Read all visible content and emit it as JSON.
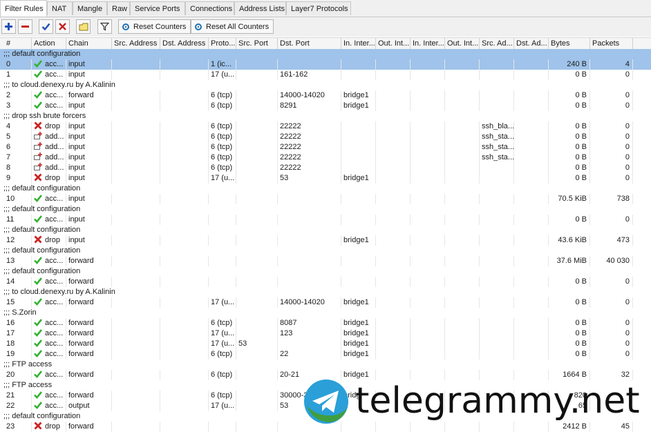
{
  "tabs": [
    "Filter Rules",
    "NAT",
    "Mangle",
    "Raw",
    "Service Ports",
    "Connections",
    "Address Lists",
    "Layer7 Protocols"
  ],
  "active_tab": 0,
  "toolbar": {
    "add_icon": "plus-icon",
    "remove_icon": "minus-icon",
    "enable_icon": "check-icon",
    "disable_icon": "x-icon",
    "comment_icon": "note-icon",
    "filter_icon": "funnel-icon",
    "reset_counters": "Reset Counters",
    "reset_all_counters": "Reset All Counters"
  },
  "columns": [
    "#",
    "Action",
    "Chain",
    "Src. Address",
    "Dst. Address",
    "Proto...",
    "Src. Port",
    "Dst. Port",
    "In. Inter...",
    "Out. Int...",
    "In. Inter...",
    "Out. Int...",
    "Src. Ad...",
    "Dst. Ad...",
    "Bytes",
    "Packets"
  ],
  "colors": {
    "selected_row": "#9fc3ea",
    "accept": "#33b233",
    "drop": "#cc2222",
    "add": "#555555",
    "watermark_blue": "#2a9fd8",
    "watermark_green": "#4caf50"
  },
  "rows": [
    {
      "type": "comment",
      "text": ";;; default configuration",
      "selected": true
    },
    {
      "type": "rule",
      "num": "0",
      "action": "acc...",
      "icon": "accept",
      "chain": "input",
      "src_addr": "",
      "dst_addr": "",
      "proto": "1 (ic...",
      "src_port": "",
      "dst_port": "",
      "in_if": "",
      "out_if": "",
      "in_if_list": "",
      "out_if_list": "",
      "src_list": "",
      "dst_list": "",
      "bytes": "240 B",
      "packets": "4",
      "selected": true
    },
    {
      "type": "rule",
      "num": "1",
      "action": "acc...",
      "icon": "accept",
      "chain": "input",
      "src_addr": "",
      "dst_addr": "",
      "proto": "17 (u...",
      "src_port": "",
      "dst_port": "161-162",
      "in_if": "",
      "out_if": "",
      "in_if_list": "",
      "out_if_list": "",
      "src_list": "",
      "dst_list": "",
      "bytes": "0 B",
      "packets": "0"
    },
    {
      "type": "comment",
      "text": ";;; to cloud.denexy.ru by A.Kalinin"
    },
    {
      "type": "rule",
      "num": "2",
      "action": "acc...",
      "icon": "accept",
      "chain": "forward",
      "src_addr": "",
      "dst_addr": "",
      "proto": "6 (tcp)",
      "src_port": "",
      "dst_port": "14000-14020",
      "in_if": "bridge1",
      "out_if": "",
      "in_if_list": "",
      "out_if_list": "",
      "src_list": "",
      "dst_list": "",
      "bytes": "0 B",
      "packets": "0"
    },
    {
      "type": "rule",
      "num": "3",
      "action": "acc...",
      "icon": "accept",
      "chain": "input",
      "src_addr": "",
      "dst_addr": "",
      "proto": "6 (tcp)",
      "src_port": "",
      "dst_port": "8291",
      "in_if": "bridge1",
      "out_if": "",
      "in_if_list": "",
      "out_if_list": "",
      "src_list": "",
      "dst_list": "",
      "bytes": "0 B",
      "packets": "0"
    },
    {
      "type": "comment",
      "text": ";;; drop ssh brute forcers"
    },
    {
      "type": "rule",
      "num": "4",
      "action": "drop",
      "icon": "drop",
      "chain": "input",
      "src_addr": "",
      "dst_addr": "",
      "proto": "6 (tcp)",
      "src_port": "",
      "dst_port": "22222",
      "in_if": "",
      "out_if": "",
      "in_if_list": "",
      "out_if_list": "",
      "src_list": "ssh_bla...",
      "dst_list": "",
      "bytes": "0 B",
      "packets": "0"
    },
    {
      "type": "rule",
      "num": "5",
      "action": "add...",
      "icon": "add",
      "chain": "input",
      "src_addr": "",
      "dst_addr": "",
      "proto": "6 (tcp)",
      "src_port": "",
      "dst_port": "22222",
      "in_if": "",
      "out_if": "",
      "in_if_list": "",
      "out_if_list": "",
      "src_list": "ssh_sta...",
      "dst_list": "",
      "bytes": "0 B",
      "packets": "0"
    },
    {
      "type": "rule",
      "num": "6",
      "action": "add...",
      "icon": "add",
      "chain": "input",
      "src_addr": "",
      "dst_addr": "",
      "proto": "6 (tcp)",
      "src_port": "",
      "dst_port": "22222",
      "in_if": "",
      "out_if": "",
      "in_if_list": "",
      "out_if_list": "",
      "src_list": "ssh_sta...",
      "dst_list": "",
      "bytes": "0 B",
      "packets": "0"
    },
    {
      "type": "rule",
      "num": "7",
      "action": "add...",
      "icon": "add",
      "chain": "input",
      "src_addr": "",
      "dst_addr": "",
      "proto": "6 (tcp)",
      "src_port": "",
      "dst_port": "22222",
      "in_if": "",
      "out_if": "",
      "in_if_list": "",
      "out_if_list": "",
      "src_list": "ssh_sta...",
      "dst_list": "",
      "bytes": "0 B",
      "packets": "0"
    },
    {
      "type": "rule",
      "num": "8",
      "action": "add...",
      "icon": "add",
      "chain": "input",
      "src_addr": "",
      "dst_addr": "",
      "proto": "6 (tcp)",
      "src_port": "",
      "dst_port": "22222",
      "in_if": "",
      "out_if": "",
      "in_if_list": "",
      "out_if_list": "",
      "src_list": "",
      "dst_list": "",
      "bytes": "0 B",
      "packets": "0"
    },
    {
      "type": "rule",
      "num": "9",
      "action": "drop",
      "icon": "drop",
      "chain": "input",
      "src_addr": "",
      "dst_addr": "",
      "proto": "17 (u...",
      "src_port": "",
      "dst_port": "53",
      "in_if": "bridge1",
      "out_if": "",
      "in_if_list": "",
      "out_if_list": "",
      "src_list": "",
      "dst_list": "",
      "bytes": "0 B",
      "packets": "0"
    },
    {
      "type": "comment",
      "text": ";;; default configuration"
    },
    {
      "type": "rule",
      "num": "10",
      "action": "acc...",
      "icon": "accept",
      "chain": "input",
      "src_addr": "",
      "dst_addr": "",
      "proto": "",
      "src_port": "",
      "dst_port": "",
      "in_if": "",
      "out_if": "",
      "in_if_list": "",
      "out_if_list": "",
      "src_list": "",
      "dst_list": "",
      "bytes": "70.5 KiB",
      "packets": "738"
    },
    {
      "type": "comment",
      "text": ";;; default configuration"
    },
    {
      "type": "rule",
      "num": "11",
      "action": "acc...",
      "icon": "accept",
      "chain": "input",
      "src_addr": "",
      "dst_addr": "",
      "proto": "",
      "src_port": "",
      "dst_port": "",
      "in_if": "",
      "out_if": "",
      "in_if_list": "",
      "out_if_list": "",
      "src_list": "",
      "dst_list": "",
      "bytes": "0 B",
      "packets": "0"
    },
    {
      "type": "comment",
      "text": ";;; default configuration"
    },
    {
      "type": "rule",
      "num": "12",
      "action": "drop",
      "icon": "drop",
      "chain": "input",
      "src_addr": "",
      "dst_addr": "",
      "proto": "",
      "src_port": "",
      "dst_port": "",
      "in_if": "bridge1",
      "out_if": "",
      "in_if_list": "",
      "out_if_list": "",
      "src_list": "",
      "dst_list": "",
      "bytes": "43.6 KiB",
      "packets": "473"
    },
    {
      "type": "comment",
      "text": ";;; default configuration"
    },
    {
      "type": "rule",
      "num": "13",
      "action": "acc...",
      "icon": "accept",
      "chain": "forward",
      "src_addr": "",
      "dst_addr": "",
      "proto": "",
      "src_port": "",
      "dst_port": "",
      "in_if": "",
      "out_if": "",
      "in_if_list": "",
      "out_if_list": "",
      "src_list": "",
      "dst_list": "",
      "bytes": "37.6 MiB",
      "packets": "40 030"
    },
    {
      "type": "comment",
      "text": ";;; default configuration"
    },
    {
      "type": "rule",
      "num": "14",
      "action": "acc...",
      "icon": "accept",
      "chain": "forward",
      "src_addr": "",
      "dst_addr": "",
      "proto": "",
      "src_port": "",
      "dst_port": "",
      "in_if": "",
      "out_if": "",
      "in_if_list": "",
      "out_if_list": "",
      "src_list": "",
      "dst_list": "",
      "bytes": "0 B",
      "packets": "0"
    },
    {
      "type": "comment",
      "text": ";;; to cloud.denexy.ru by A.Kalinin"
    },
    {
      "type": "rule",
      "num": "15",
      "action": "acc...",
      "icon": "accept",
      "chain": "forward",
      "src_addr": "",
      "dst_addr": "",
      "proto": "17 (u...",
      "src_port": "",
      "dst_port": "14000-14020",
      "in_if": "bridge1",
      "out_if": "",
      "in_if_list": "",
      "out_if_list": "",
      "src_list": "",
      "dst_list": "",
      "bytes": "0 B",
      "packets": "0"
    },
    {
      "type": "comment",
      "text": ";;; S.Zorin"
    },
    {
      "type": "rule",
      "num": "16",
      "action": "acc...",
      "icon": "accept",
      "chain": "forward",
      "src_addr": "",
      "dst_addr": "",
      "proto": "6 (tcp)",
      "src_port": "",
      "dst_port": "8087",
      "in_if": "bridge1",
      "out_if": "",
      "in_if_list": "",
      "out_if_list": "",
      "src_list": "",
      "dst_list": "",
      "bytes": "0 B",
      "packets": "0"
    },
    {
      "type": "rule",
      "num": "17",
      "action": "acc...",
      "icon": "accept",
      "chain": "forward",
      "src_addr": "",
      "dst_addr": "",
      "proto": "17 (u...",
      "src_port": "",
      "dst_port": "123",
      "in_if": "bridge1",
      "out_if": "",
      "in_if_list": "",
      "out_if_list": "",
      "src_list": "",
      "dst_list": "",
      "bytes": "0 B",
      "packets": "0"
    },
    {
      "type": "rule",
      "num": "18",
      "action": "acc...",
      "icon": "accept",
      "chain": "forward",
      "src_addr": "",
      "dst_addr": "",
      "proto": "17 (u...",
      "src_port": "53",
      "dst_port": "",
      "in_if": "bridge1",
      "out_if": "",
      "in_if_list": "",
      "out_if_list": "",
      "src_list": "",
      "dst_list": "",
      "bytes": "0 B",
      "packets": "0"
    },
    {
      "type": "rule",
      "num": "19",
      "action": "acc...",
      "icon": "accept",
      "chain": "forward",
      "src_addr": "",
      "dst_addr": "",
      "proto": "6 (tcp)",
      "src_port": "",
      "dst_port": "22",
      "in_if": "bridge1",
      "out_if": "",
      "in_if_list": "",
      "out_if_list": "",
      "src_list": "",
      "dst_list": "",
      "bytes": "0 B",
      "packets": "0"
    },
    {
      "type": "comment",
      "text": ";;; FTP access"
    },
    {
      "type": "rule",
      "num": "20",
      "action": "acc...",
      "icon": "accept",
      "chain": "forward",
      "src_addr": "",
      "dst_addr": "",
      "proto": "6 (tcp)",
      "src_port": "",
      "dst_port": "20-21",
      "in_if": "bridge1",
      "out_if": "",
      "in_if_list": "",
      "out_if_list": "",
      "src_list": "",
      "dst_list": "",
      "bytes": "1664 B",
      "packets": "32"
    },
    {
      "type": "comment",
      "text": ";;; FTP access"
    },
    {
      "type": "rule",
      "num": "21",
      "action": "acc...",
      "icon": "accept",
      "chain": "forward",
      "src_addr": "",
      "dst_addr": "",
      "proto": "6 (tcp)",
      "src_port": "",
      "dst_port": "30000-3",
      "in_if": "bridg",
      "out_if": "",
      "in_if_list": "",
      "out_if_list": "",
      "src_list": "",
      "dst_list": "",
      "bytes": "820",
      "packets": ""
    },
    {
      "type": "rule",
      "num": "22",
      "action": "acc...",
      "icon": "accept",
      "chain": "output",
      "src_addr": "",
      "dst_addr": "",
      "proto": "17 (u...",
      "src_port": "",
      "dst_port": "53",
      "in_if": "",
      "out_if": "",
      "in_if_list": "",
      "out_if_list": "",
      "src_list": "",
      "dst_list": "",
      "bytes": "65",
      "packets": ""
    },
    {
      "type": "comment",
      "text": ";;; default configuration"
    },
    {
      "type": "rule",
      "num": "23",
      "action": "drop",
      "icon": "drop",
      "chain": "forward",
      "src_addr": "",
      "dst_addr": "",
      "proto": "",
      "src_port": "",
      "dst_port": "",
      "in_if": "",
      "out_if": "",
      "in_if_list": "",
      "out_if_list": "",
      "src_list": "",
      "dst_list": "",
      "bytes": "2412 B",
      "packets": "45"
    }
  ],
  "watermark": {
    "text": "telegrammy.net",
    "icon": "telegram-logo-icon"
  }
}
